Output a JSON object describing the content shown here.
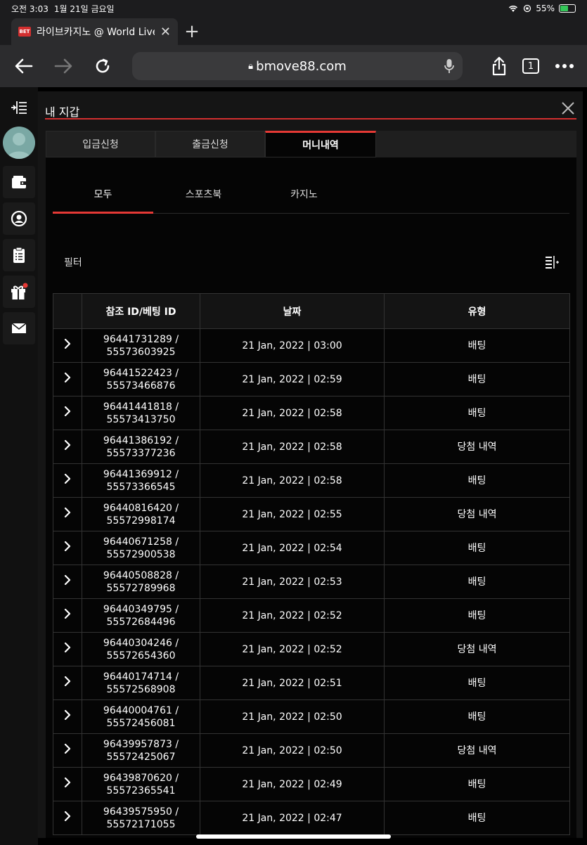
{
  "status_bar": {
    "time": "오전 3:03",
    "date": "1월 21일 금요일",
    "battery": "55%",
    "battery_level": 0.55
  },
  "browser": {
    "tab_favicon": "BET",
    "tab_title": "라이브카지노 @ World Live",
    "url": "bmove88.com",
    "tab_count": "1"
  },
  "wallet": {
    "title": "내 지갑",
    "tabs": [
      "입금신청",
      "출금신청",
      "머니내역"
    ],
    "active_tab": 2,
    "sub_tabs": [
      "모두",
      "스포츠북",
      "카지노"
    ],
    "active_sub_tab": 0,
    "filter_label": "필터",
    "columns": [
      "참조 ID/베팅 ID",
      "날짜",
      "유형"
    ],
    "rows": [
      {
        "ref": "96441731289 /",
        "bet": "55573603925",
        "date": "21 Jan, 2022 | 03:00",
        "type": "배팅"
      },
      {
        "ref": "96441522423 /",
        "bet": "55573466876",
        "date": "21 Jan, 2022 | 02:59",
        "type": "배팅"
      },
      {
        "ref": "96441441818 /",
        "bet": "55573413750",
        "date": "21 Jan, 2022 | 02:58",
        "type": "배팅"
      },
      {
        "ref": "96441386192 /",
        "bet": "55573377236",
        "date": "21 Jan, 2022 | 02:58",
        "type": "당첨 내역"
      },
      {
        "ref": "96441369912 /",
        "bet": "55573366545",
        "date": "21 Jan, 2022 | 02:58",
        "type": "배팅"
      },
      {
        "ref": "96440816420 /",
        "bet": "55572998174",
        "date": "21 Jan, 2022 | 02:55",
        "type": "당첨 내역"
      },
      {
        "ref": "96440671258 /",
        "bet": "55572900538",
        "date": "21 Jan, 2022 | 02:54",
        "type": "배팅"
      },
      {
        "ref": "96440508828 /",
        "bet": "55572789968",
        "date": "21 Jan, 2022 | 02:53",
        "type": "배팅"
      },
      {
        "ref": "96440349795 /",
        "bet": "55572684496",
        "date": "21 Jan, 2022 | 02:52",
        "type": "배팅"
      },
      {
        "ref": "96440304246 /",
        "bet": "55572654360",
        "date": "21 Jan, 2022 | 02:52",
        "type": "당첨 내역"
      },
      {
        "ref": "96440174714 /",
        "bet": "55572568908",
        "date": "21 Jan, 2022 | 02:51",
        "type": "배팅"
      },
      {
        "ref": "96440004761 /",
        "bet": "55572456081",
        "date": "21 Jan, 2022 | 02:50",
        "type": "배팅"
      },
      {
        "ref": "96439957873 /",
        "bet": "55572425067",
        "date": "21 Jan, 2022 | 02:50",
        "type": "당첨 내역"
      },
      {
        "ref": "96439870620 /",
        "bet": "55572365541",
        "date": "21 Jan, 2022 | 02:49",
        "type": "배팅"
      },
      {
        "ref": "96439575950 /",
        "bet": "55572171055",
        "date": "21 Jan, 2022 | 02:47",
        "type": "배팅"
      }
    ]
  },
  "colors": {
    "accent": "#e53935",
    "background": "#050505",
    "panel": "#151515"
  },
  "icons": {
    "sidebar": [
      "menu-collapse-icon",
      "avatar",
      "wallet-icon",
      "profile-icon",
      "clipboard-icon",
      "gift-icon",
      "mail-icon"
    ],
    "row": "chevron-right-icon",
    "filter": "filter-sort-icon"
  }
}
